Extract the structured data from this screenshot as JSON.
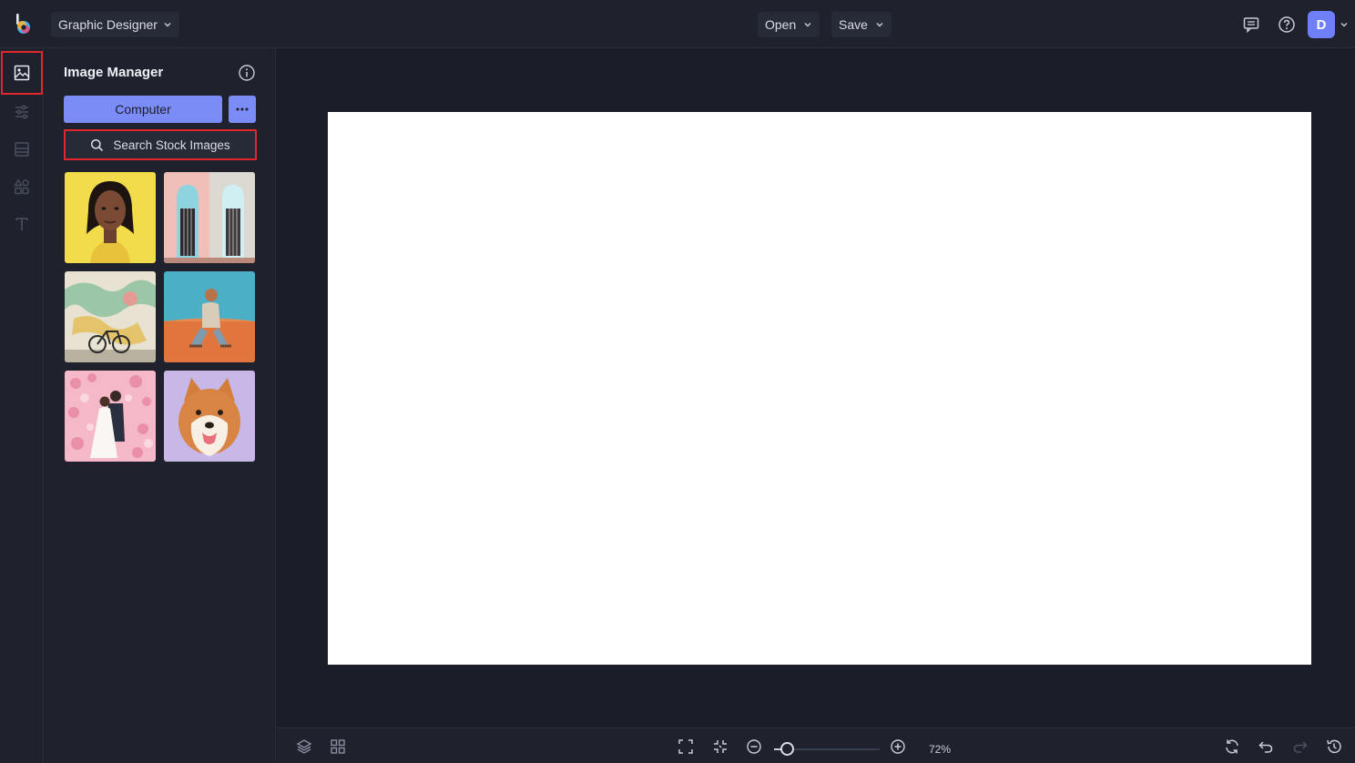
{
  "app": {
    "switcher_label": "Graphic Designer"
  },
  "toolbar": {
    "open_label": "Open",
    "save_label": "Save",
    "avatar_initial": "D"
  },
  "rail": {
    "items": [
      {
        "name": "image-manager",
        "icon": "image-icon",
        "active": true
      },
      {
        "name": "adjust",
        "icon": "sliders-icon",
        "active": false
      },
      {
        "name": "layout",
        "icon": "layout-icon",
        "active": false
      },
      {
        "name": "graphics",
        "icon": "shapes-icon",
        "active": false
      },
      {
        "name": "text",
        "icon": "text-icon",
        "active": false
      }
    ]
  },
  "panel": {
    "title": "Image Manager",
    "computer_button": "Computer",
    "search_button": "Search Stock Images",
    "thumbnails": [
      {
        "subject": "woman-portrait-yellow"
      },
      {
        "subject": "pink-building-doors"
      },
      {
        "subject": "mural-with-bicycle"
      },
      {
        "subject": "man-sitting-on-sand"
      },
      {
        "subject": "wedding-couple-flowers"
      },
      {
        "subject": "shiba-inu-dog"
      }
    ]
  },
  "zoom": {
    "label": "72%",
    "level": 0.12
  },
  "colors": {
    "accent": "#7b8cf6",
    "highlight": "#e0262b",
    "background": "#1b1e29",
    "panel": "#1f222d"
  }
}
